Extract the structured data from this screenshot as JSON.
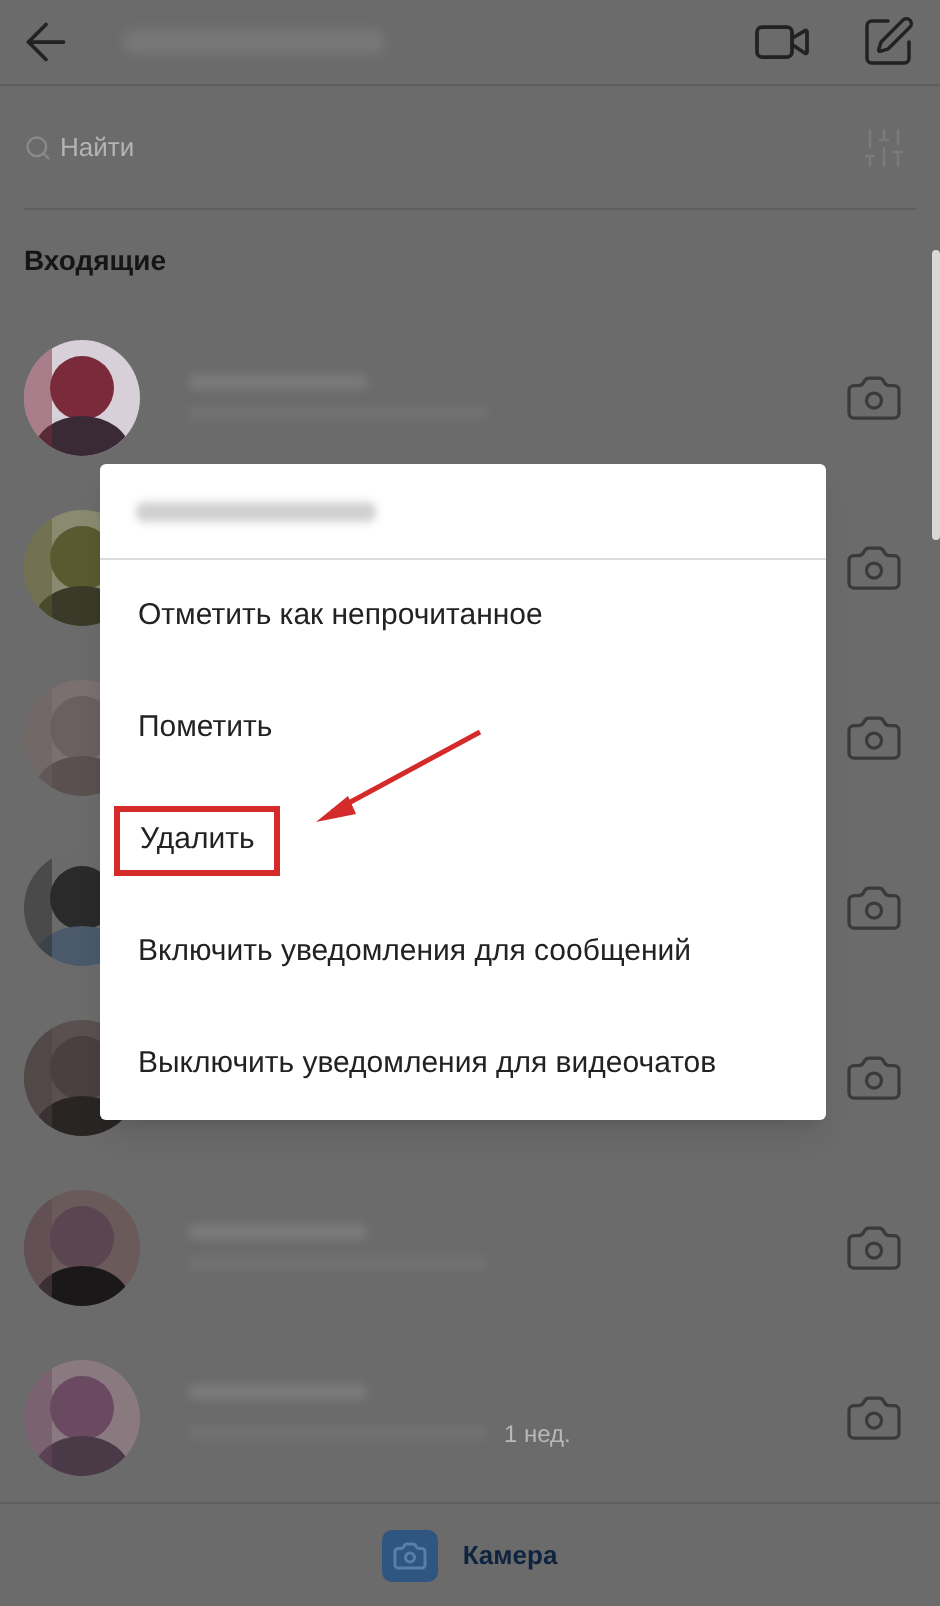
{
  "search": {
    "placeholder": "Найти"
  },
  "section_title": "Входящие",
  "conversations": [
    {
      "avatar": {
        "kind": "picture"
      },
      "preview": {
        "kind": "blurred"
      }
    },
    {
      "avatar": {
        "kind": "picture"
      }
    },
    {
      "avatar": {
        "kind": "picture"
      }
    },
    {
      "avatar": {
        "kind": "picture"
      }
    },
    {
      "avatar": {
        "kind": "picture"
      }
    },
    {
      "avatar": {
        "kind": "picture"
      },
      "preview": {
        "kind": "blurred"
      }
    },
    {
      "avatar": {
        "kind": "picture"
      },
      "preview": {
        "kind": "blurred"
      },
      "time": "1 нед."
    }
  ],
  "context_menu": {
    "items": [
      {
        "label": "Отметить как непрочитанное",
        "annotated": false
      },
      {
        "label": "Пометить",
        "annotated": false
      },
      {
        "label": "Удалить",
        "annotated": true
      },
      {
        "label": "Включить уведомления для сообщений",
        "annotated": false
      },
      {
        "label": "Выключить уведомления для видеочатов",
        "annotated": false
      }
    ]
  },
  "bottom_bar": {
    "label": "Камера"
  }
}
